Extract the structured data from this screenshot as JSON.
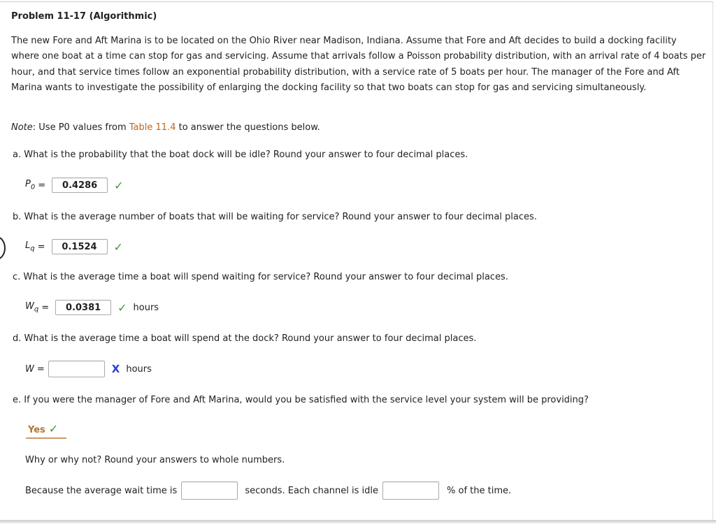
{
  "title": "Problem 11-17 (Algorithmic)",
  "intro": "The new Fore and Aft Marina is to be located on the Ohio River near Madison, Indiana. Assume that Fore and Aft decides to build a docking facility where one boat at a time can stop for gas and servicing. Assume that arrivals follow a Poisson probability distribution, with an arrival rate of 4 boats per hour, and that service times follow an exponential probability distribution, with a service rate of 5 boats per hour. The manager of the Fore and Aft Marina wants to investigate the possibility of enlarging the docking facility so that two boats can stop for gas and servicing simultaneously.",
  "note": {
    "label": "Note",
    "prefix": ": Use P0 values from ",
    "link": "Table 11.4",
    "suffix": " to answer the questions below."
  },
  "questions": [
    {
      "text": "a. What is the probability that the boat dock will be idle? Round your answer to four decimal places.",
      "var": "P0",
      "value": "0.4286",
      "status": "correct",
      "unit": ""
    },
    {
      "text": "b. What is the average number of boats that will be waiting for service? Round your answer to four decimal places.",
      "var": "Lq",
      "value": "0.1524",
      "status": "correct",
      "unit": ""
    },
    {
      "text": "c. What is the average time a boat will spend waiting for service? Round your answer to four decimal places.",
      "var": "Wq",
      "value": "0.0381",
      "status": "correct",
      "unit": "hours"
    },
    {
      "text": "d. What is the average time a boat will spend at the dock? Round your answer to four decimal places.",
      "var": "W",
      "value": "",
      "status": "incorrect",
      "unit": "hours"
    },
    {
      "text": "e. If you were the manager of Fore and Aft Marina, would you be satisfied with the service level your system will be providing?",
      "selected": "Yes",
      "status": "correct"
    }
  ],
  "why": {
    "prompt": "Why or why not? Round your answers to whole numbers.",
    "part1": "Because the average wait time is",
    "value1": "",
    "part2": "seconds. Each channel is idle",
    "value2": "",
    "part3": "% of the time."
  },
  "symbols": {
    "eq": "=",
    "check": "✓",
    "cross": "X"
  },
  "colors": {
    "link": "#c0651e",
    "correct": "#3a9a3a",
    "incorrect": "#2a3ed8"
  }
}
